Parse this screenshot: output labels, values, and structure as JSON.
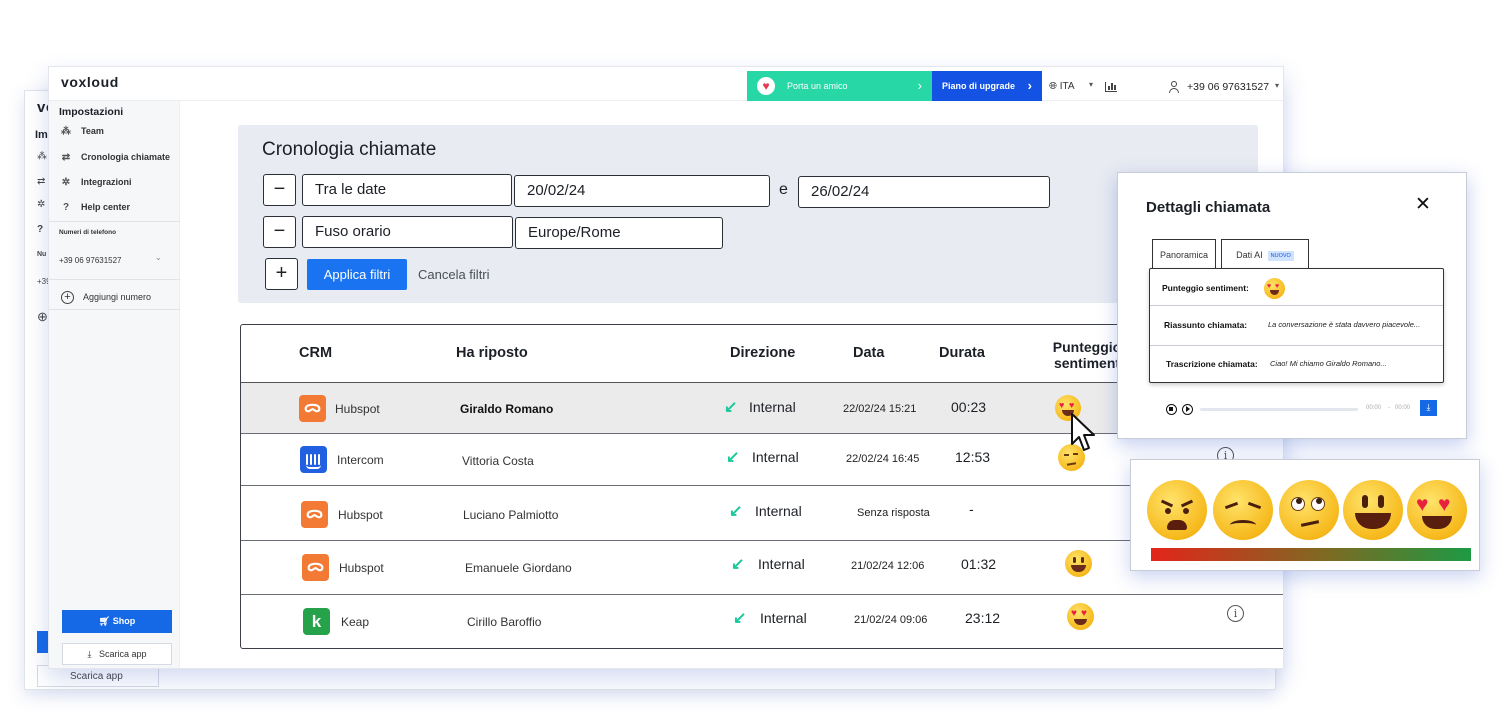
{
  "back_window": {
    "logo": "vo",
    "label": "Im",
    "phone": "+39",
    "sub": "Nu",
    "download": "Scarica app"
  },
  "topbar": {
    "logo": "voxloud",
    "invite_label": "Porta un amico",
    "upgrade_label": "Piano di upgrade",
    "language": "ITA",
    "phone": "+39 06 97631527"
  },
  "sidebar": {
    "title": "Impostazioni",
    "items": [
      {
        "label": "Team",
        "icon": "team-icon"
      },
      {
        "label": "Cronologia chiamate",
        "icon": "arrows-icon"
      },
      {
        "label": "Integrazioni",
        "icon": "integrations-icon"
      },
      {
        "label": "Help center",
        "icon": "question-icon"
      }
    ],
    "phone_section": "Numeri di telefono",
    "phone_number": "+39 06 97631527",
    "add_number": "Aggiungi numero",
    "shop": "Shop",
    "download": "Scarica app"
  },
  "filters": {
    "title": "Cronologia chiamate",
    "row1": {
      "field": "Tra le date",
      "from": "20/02/24",
      "connector": "e",
      "to": "26/02/24"
    },
    "row2": {
      "field": "Fuso orario",
      "value": "Europe/Rome"
    },
    "minus": "−",
    "plus": "+",
    "apply": "Applica filtri",
    "cancel": "Cancela filtri"
  },
  "table": {
    "headers": {
      "crm": "CRM",
      "answered": "Ha riposto",
      "direction": "Direzione",
      "date": "Data",
      "duration": "Durata",
      "sentiment": "Punteggio sentiment"
    },
    "rows": [
      {
        "crm": "Hubspot",
        "crm_icon": "hubspot-logo",
        "answered": "Giraldo Romano",
        "direction": "Internal",
        "date": "22/02/24 15:21",
        "duration": "00:23",
        "sentiment": "heart-eyes"
      },
      {
        "crm": "Intercom",
        "crm_icon": "intercom-logo",
        "answered": "Vittoria Costa",
        "direction": "Internal",
        "date": "22/02/24 16:45",
        "duration": "12:53",
        "sentiment": "neutral"
      },
      {
        "crm": "Hubspot",
        "crm_icon": "hubspot-logo",
        "answered": "Luciano Palmiotto",
        "direction": "Internal",
        "date": "Senza risposta",
        "duration": "-",
        "sentiment": ""
      },
      {
        "crm": "Hubspot",
        "crm_icon": "hubspot-logo",
        "answered": "Emanuele Giordano",
        "direction": "Internal",
        "date": "21/02/24 12:06",
        "duration": "01:32",
        "sentiment": "grin"
      },
      {
        "crm": "Keap",
        "crm_icon": "keap-logo",
        "answered": "Cirillo Baroffio",
        "direction": "Internal",
        "date": "21/02/24 09:06",
        "duration": "23:12",
        "sentiment": "heart-eyes"
      }
    ]
  },
  "detail": {
    "title": "Dettagli chiamata",
    "tabs": [
      "Panoramica",
      "Dati AI"
    ],
    "new_badge": "NUOVO",
    "sentiment_label": "Punteggio sentiment:",
    "summary_label": "Riassunto chiamata:",
    "summary_value": "La conversazione è stata davvero piacevole...",
    "transcript_label": "Trascrizione chiamata:",
    "transcript_value": "Ciao! Mi chiamo Giraldo Romano...",
    "time_start": "00:00",
    "time_sep": "-",
    "time_end": "00:00"
  },
  "scale": {
    "emojis": [
      "angry",
      "sad",
      "eye-roll",
      "grin",
      "heart-eyes"
    ],
    "gradient": [
      "#e3251b",
      "#7d6a22",
      "#1d9a45"
    ]
  },
  "colors": {
    "primary_blue": "#1669e6",
    "upgrade_blue": "#1452e3",
    "invite_green": "#27d7a6",
    "direction_green": "#18c99b",
    "hubspot_orange": "#f27a35",
    "keap_green": "#25a24a"
  }
}
